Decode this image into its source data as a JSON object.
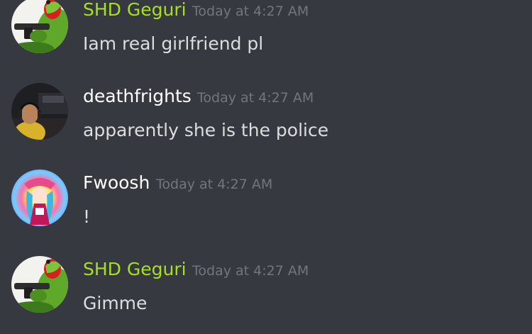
{
  "colors": {
    "background": "#36393f",
    "timestamp": "#72767d",
    "message_text": "#dcddde",
    "role_green": "#a8e01f",
    "default_name": "#ffffff"
  },
  "messages": [
    {
      "author": "SHD Geguri",
      "author_color": "#a8e01f",
      "avatar": "frog-avatar",
      "timestamp": "Today at 4:27 AM",
      "content": "Iam real girlfriend pl"
    },
    {
      "author": "deathfrights",
      "author_color": "#ffffff",
      "avatar": "streamer-photo-avatar",
      "timestamp": "Today at 4:27 AM",
      "content": "apparently she is the police"
    },
    {
      "author": "Fwoosh",
      "author_color": "#ffffff",
      "avatar": "anime-character-avatar",
      "timestamp": "Today at 4:27 AM",
      "content": "!"
    },
    {
      "author": "SHD Geguri",
      "author_color": "#a8e01f",
      "avatar": "frog-avatar",
      "timestamp": "Today at 4:27 AM",
      "content": "Gimme"
    }
  ]
}
